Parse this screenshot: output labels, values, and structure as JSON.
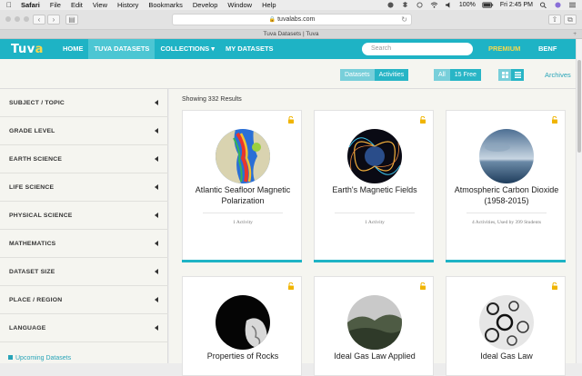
{
  "menubar": {
    "items": [
      "Safari",
      "File",
      "Edit",
      "View",
      "History",
      "Bookmarks",
      "Develop",
      "Window",
      "Help"
    ],
    "battery": "100%",
    "time": "Fri 2:45 PM"
  },
  "browser": {
    "url": "tuvalabs.com",
    "tab_title": "Tuva Datasets | Tuva"
  },
  "sitenav": {
    "logo_left": "Tuv",
    "logo_right": "a",
    "items": [
      {
        "label": "HOME"
      },
      {
        "label": "TUVA DATASETS"
      },
      {
        "label": "COLLECTIONS ▾"
      },
      {
        "label": "MY DATASETS"
      }
    ],
    "search_placeholder": "Search",
    "premium": "PREMIUM",
    "user": "BENF"
  },
  "toolbar": {
    "type_toggle": [
      "Datasets",
      "Activities"
    ],
    "filter_toggle": [
      "All",
      "15 Free"
    ],
    "archives": "Archives"
  },
  "sidebar": {
    "filters": [
      "SUBJECT / TOPIC",
      "GRADE LEVEL",
      "EARTH SCIENCE",
      "LIFE SCIENCE",
      "PHYSICAL SCIENCE",
      "MATHEMATICS",
      "DATASET SIZE",
      "PLACE / REGION",
      "LANGUAGE"
    ],
    "upcoming": "Upcoming Datasets"
  },
  "results": {
    "showing": "Showing 332 Results",
    "cards": [
      {
        "title": "Atlantic Seafloor Magnetic Polarization",
        "meta": "1 Activity",
        "image": "atlantic-map-image"
      },
      {
        "title": "Earth's Magnetic Fields",
        "meta": "1 Activity",
        "image": "magnetic-field-image"
      },
      {
        "title": "Atmospheric Carbon Dioxide (1958-2015)",
        "meta": "4 Activities, Used by 399 Students",
        "image": "ocean-sky-image"
      },
      {
        "title": "Properties of Rocks",
        "meta": "",
        "image": "rock-image"
      },
      {
        "title": "Ideal Gas Law Applied",
        "meta": "",
        "image": "mountain-image"
      },
      {
        "title": "Ideal Gas Law",
        "meta": "",
        "image": "particles-image"
      }
    ]
  }
}
